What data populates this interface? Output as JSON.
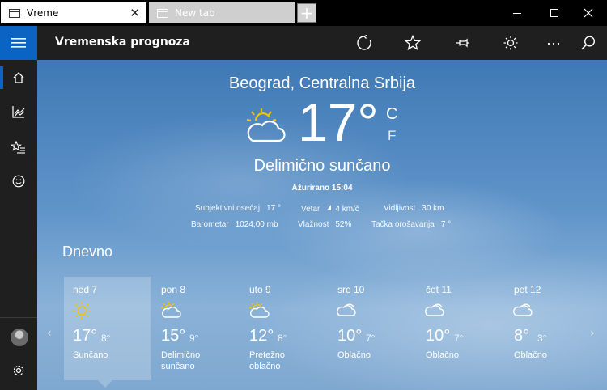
{
  "tabs": [
    {
      "label": "Vreme"
    },
    {
      "label": "New tab"
    }
  ],
  "app": {
    "title": "Vremenska prognoza"
  },
  "current": {
    "location": "Beograd, Centralna Srbija",
    "temperature": "17°",
    "unit_c": "C",
    "unit_f": "F",
    "condition": "Delimično sunčano",
    "updated": "Ažurirano 15:04",
    "icon": "partly-sunny-icon"
  },
  "details": {
    "feels_label": "Subjektivni osećaj",
    "feels_value": "17 °",
    "wind_label": "Vetar",
    "wind_value": "4 km/č",
    "visibility_label": "Vidljivost",
    "visibility_value": "30 km",
    "barometer_label": "Barometar",
    "barometer_value": "1024,00 mb",
    "humidity_label": "Vlažnost",
    "humidity_value": "52%",
    "dew_label": "Tačka orošavanja",
    "dew_value": "7 °"
  },
  "forecast": {
    "heading": "Dnevno",
    "days": [
      {
        "name": "ned 7",
        "high": "17°",
        "low": "8°",
        "cond": "Sunčano",
        "icon": "sunny-icon"
      },
      {
        "name": "pon 8",
        "high": "15°",
        "low": "9°",
        "cond": "Delimično sunčano",
        "icon": "partly-sunny-icon"
      },
      {
        "name": "uto 9",
        "high": "12°",
        "low": "8°",
        "cond": "Pretežno oblačno",
        "icon": "partly-sunny-icon"
      },
      {
        "name": "sre 10",
        "high": "10°",
        "low": "7°",
        "cond": "Oblačno",
        "icon": "cloudy-icon"
      },
      {
        "name": "čet 11",
        "high": "10°",
        "low": "7°",
        "cond": "Oblačno",
        "icon": "cloudy-icon"
      },
      {
        "name": "pet 12",
        "high": "8°",
        "low": "3°",
        "cond": "Oblačno",
        "icon": "cloudy-icon"
      }
    ]
  },
  "colors": {
    "accent": "#0a64c3",
    "sun": "#f2c500"
  }
}
